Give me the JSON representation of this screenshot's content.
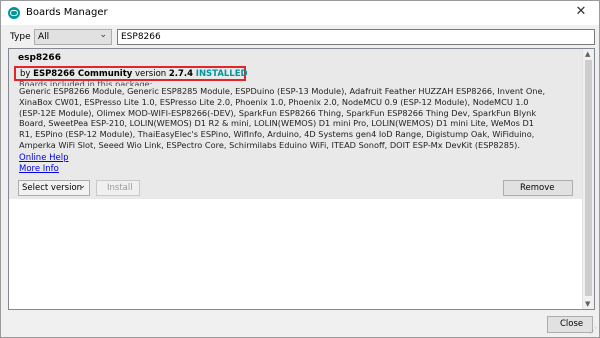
{
  "window": {
    "title": "Boards Manager",
    "close_glyph": "✕"
  },
  "filter": {
    "type_label": "Type",
    "type_value": "All",
    "search_value": "ESP8266"
  },
  "entry": {
    "name": "esp8266",
    "by_prefix": "by",
    "author": "ESP8266 Community",
    "version_word": "version",
    "version": "2.7.4",
    "status": "INSTALLED",
    "boards_header": "Boards included in this package:",
    "boards_lines": [
      "Generic ESP8266 Module, Generic ESP8285 Module, ESPDuino (ESP-13 Module), Adafruit Feather HUZZAH ESP8266, Invent One,",
      "XinaBox CW01, ESPresso Lite 1.0, ESPresso Lite 2.0, Phoenix 1.0, Phoenix 2.0, NodeMCU 0.9 (ESP-12 Module), NodeMCU 1.0",
      "(ESP-12E Module), Olimex MOD-WIFI-ESP8266(-DEV), SparkFun ESP8266 Thing, SparkFun ESP8266 Thing Dev, SparkFun Blynk",
      "Board, SweetPea ESP-210, LOLIN(WEMOS) D1 R2 & mini, LOLIN(WEMOS) D1 mini Pro, LOLIN(WEMOS) D1 mini Lite, WeMos D1",
      "R1, ESPino (ESP-12 Module), ThaiEasyElec's ESPino, WifInfo, Arduino, 4D Systems gen4 IoD Range, Digistump Oak, WiFiduino,",
      "Amperka WiFi Slot, Seeed Wio Link, ESPectro Core, Schirmilabs Eduino WiFi, ITEAD Sonoff, DOIT ESP-Mx DevKit (ESP8285)."
    ],
    "online_help": "Online Help",
    "more_info": "More Info",
    "select_version": "Select version",
    "install": "Install",
    "remove": "Remove"
  },
  "footer": {
    "close": "Close"
  },
  "colors": {
    "accent": "#00979c",
    "highlight_box": "#e0252b",
    "link": "#0000ee"
  },
  "icons": [
    "arduino-app-icon",
    "close-icon",
    "chevron-down-icon",
    "scroll-up-icon",
    "scroll-down-icon"
  ]
}
